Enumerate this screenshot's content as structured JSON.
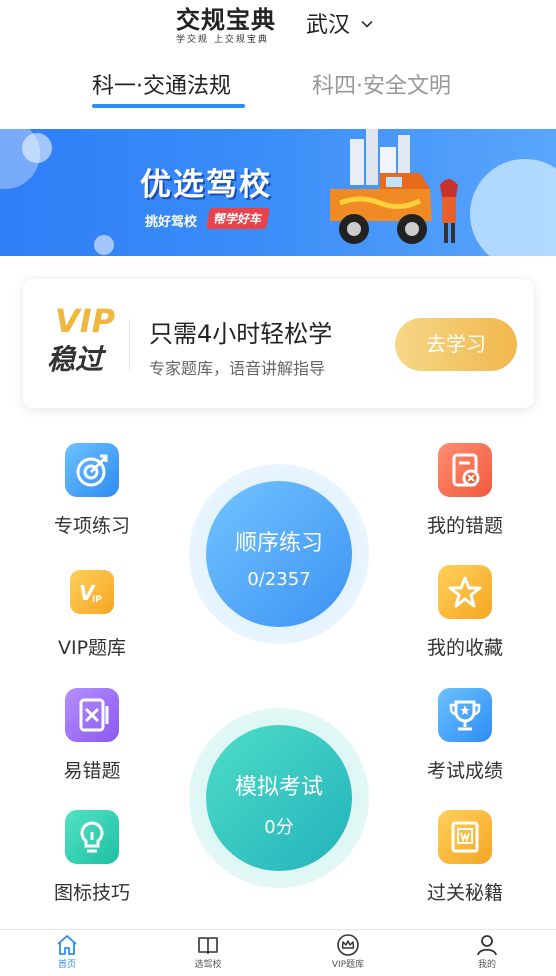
{
  "header": {
    "logo_text": "交规宝典",
    "logo_tagline": "学交规 上交规宝典",
    "city": "武汉",
    "city_chevron_icon": "chevron-down-icon"
  },
  "tabs": [
    {
      "label": "科一·交通法规",
      "active": true
    },
    {
      "label": "科四·安全文明",
      "active": false
    }
  ],
  "banner": {
    "title": "优选驾校",
    "subtitle_left": "挑好驾校",
    "subtitle_tag": "帮学好车"
  },
  "vip_card": {
    "badge_top": "VIP",
    "badge_bottom": "稳过",
    "headline": "只需4小时轻松学",
    "description": "专家题库，语音讲解指导",
    "button_label": "去学习"
  },
  "left_items": [
    {
      "label": "专项练习",
      "icon": "target-icon",
      "color": "#3f9cf5"
    },
    {
      "label": "VIP题库",
      "icon": "vip-icon",
      "color": "#f5b532"
    },
    {
      "label": "易错题",
      "icon": "error-book-icon",
      "color": "#9a6cf0"
    },
    {
      "label": "图标技巧",
      "icon": "lightbulb-icon",
      "color": "#2fc9b0"
    }
  ],
  "right_items": [
    {
      "label": "我的错题",
      "icon": "wrong-note-icon",
      "color": "#f66a4b"
    },
    {
      "label": "我的收藏",
      "icon": "star-icon",
      "color": "#f5a623"
    },
    {
      "label": "考试成绩",
      "icon": "trophy-icon",
      "color": "#3f9cf5"
    },
    {
      "label": "过关秘籍",
      "icon": "secret-book-icon",
      "color": "#f5a623"
    }
  ],
  "practice_circle": {
    "title": "顺序练习",
    "progress": "0/2357"
  },
  "exam_circle": {
    "title": "模拟考试",
    "score": "0分"
  },
  "bottom_nav": [
    {
      "label": "首页",
      "icon": "home-icon",
      "active": true
    },
    {
      "label": "选驾校",
      "icon": "book-icon",
      "active": false
    },
    {
      "label": "VIP题库",
      "icon": "crown-icon",
      "active": false
    },
    {
      "label": "我的",
      "icon": "user-icon",
      "active": false
    }
  ],
  "colors": {
    "accent": "#2b8ef0",
    "vip_gold": "#f1b63c"
  }
}
